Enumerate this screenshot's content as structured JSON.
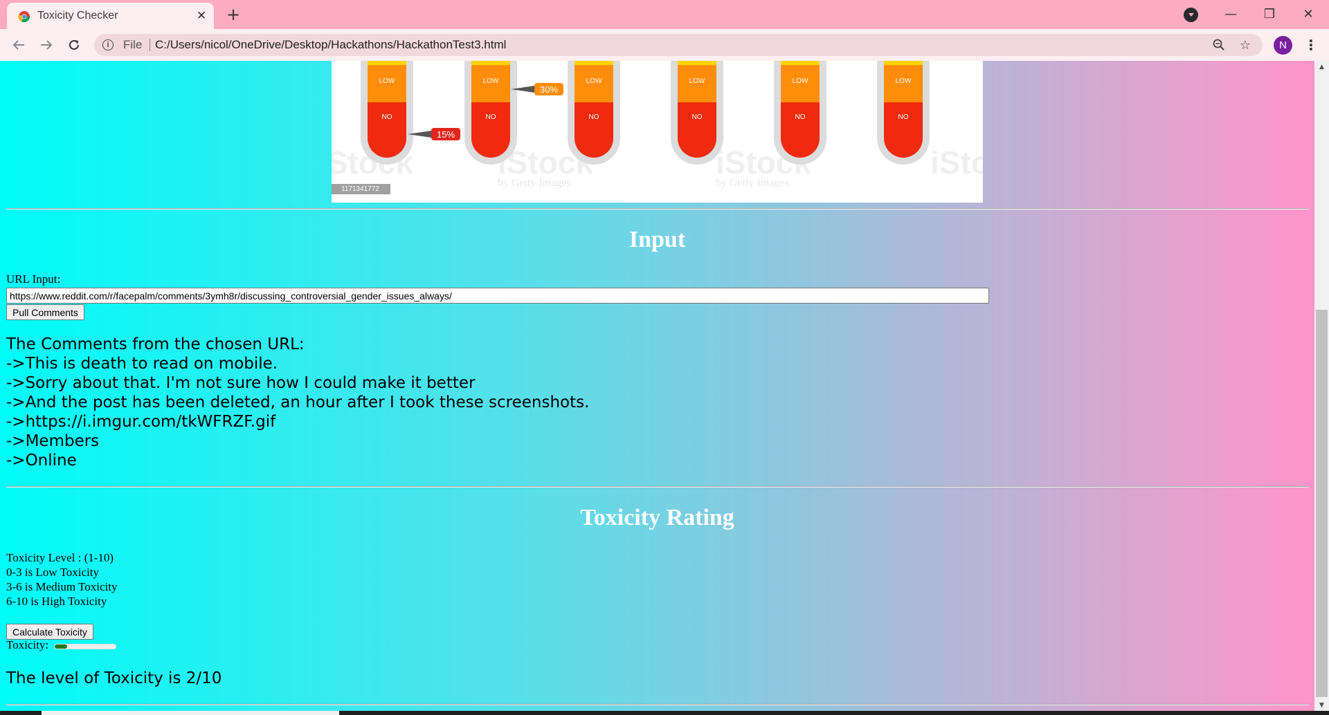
{
  "browser": {
    "tab_title": "Toxicity Checker",
    "tab_close": "✕",
    "new_tab": "+",
    "scheme": "File",
    "url": "C:/Users/nicol/OneDrive/Desktop/Hackathons/HackathonTest3.html",
    "profile_initial": "N",
    "window_minimize": "—",
    "window_restore": "❐",
    "window_close": "✕"
  },
  "icons": {
    "back": "back-arrow-icon",
    "forward": "forward-arrow-icon",
    "reload": "reload-icon",
    "info": "info-icon",
    "zoom": "zoom-icon",
    "star": "bookmark-star-icon",
    "menu": "kebab-menu-icon"
  },
  "banner": {
    "tubes": [
      {
        "low": "LOW",
        "no": "NO"
      },
      {
        "low": "LOW",
        "no": "NO"
      },
      {
        "low": "LOW",
        "no": "NO"
      },
      {
        "low": "LOW",
        "no": "NO"
      },
      {
        "low": "LOW",
        "no": "NO"
      },
      {
        "low": "LOW",
        "no": "NO"
      }
    ],
    "badge_1": "15%",
    "badge_2": "30%",
    "watermark": "iStock",
    "watermark_sub": "by Getty Images",
    "stock_id": "1171341772"
  },
  "input_section": {
    "heading": "Input",
    "url_label": "URL Input:",
    "url_value": "https://www.reddit.com/r/facepalm/comments/3ymh8r/discussing_controversial_gender_issues_always/",
    "pull_button": "Pull Comments",
    "comments_title": "The Comments from the chosen URL:",
    "comments": [
      "->This is death to read on mobile.",
      "->Sorry about that. I'm not sure how I could make it better",
      "->And the post has been deleted, an hour after I took these screenshots.",
      "->https://i.imgur.com/tkWFRZF.gif",
      "->Members",
      "->Online"
    ]
  },
  "toxicity_section": {
    "heading": "Toxicity Rating",
    "level_lines": [
      "Toxicity Level : (1-10)",
      "0-3 is Low Toxicity",
      "3-6 is Medium Toxicity",
      "6-10 is High Toxicity"
    ],
    "calculate_button": "Calculate Toxicity",
    "meter_label": "Toxicity:",
    "meter_value": 2,
    "meter_max": 10,
    "result": "The level of Toxicity is 2/10"
  },
  "colors": {
    "gradient_left": "#00fcf8",
    "gradient_right": "#ff94c9",
    "meter_fill": "#1e7a1e",
    "chrome_tabbar": "#fcabc0"
  }
}
